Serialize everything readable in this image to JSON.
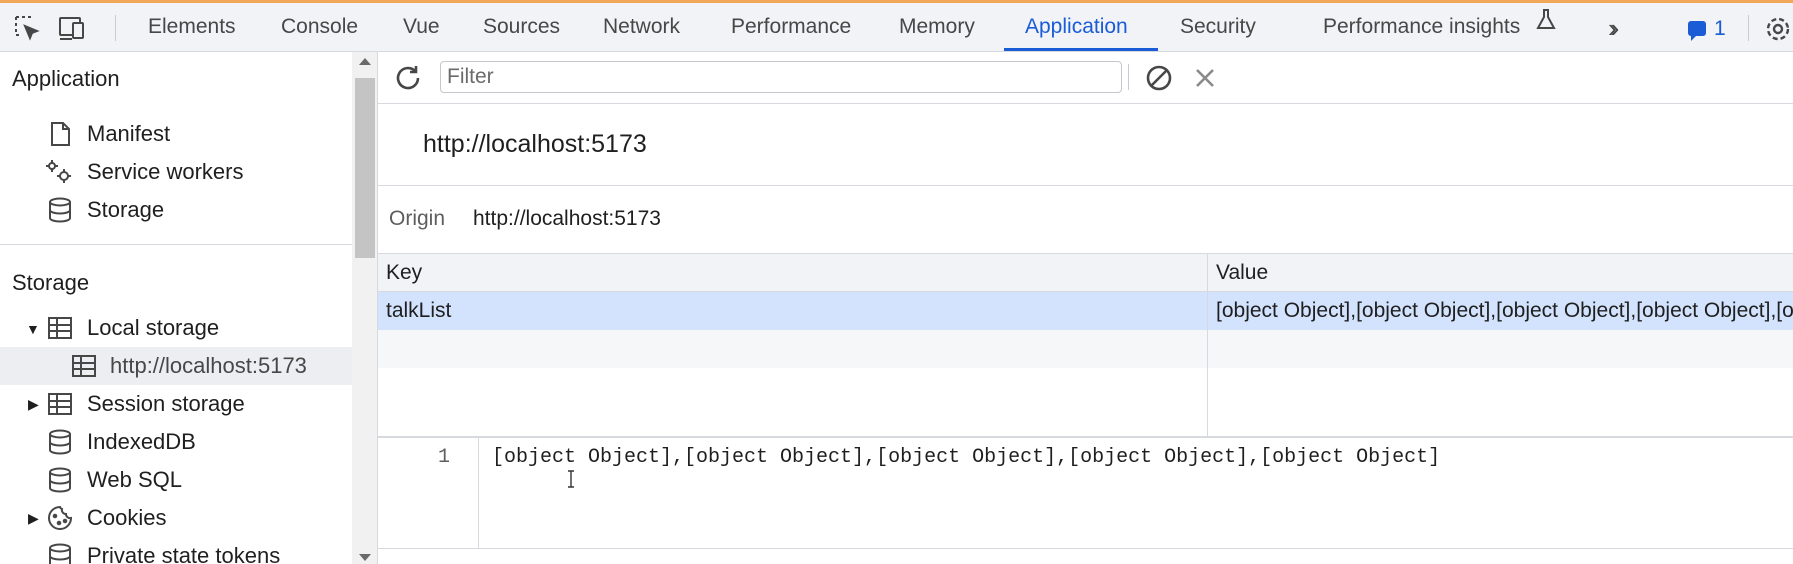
{
  "tabs": [
    {
      "label": "Elements"
    },
    {
      "label": "Console"
    },
    {
      "label": "Vue"
    },
    {
      "label": "Sources"
    },
    {
      "label": "Network"
    },
    {
      "label": "Performance"
    },
    {
      "label": "Memory"
    },
    {
      "label": "Application",
      "active": true
    },
    {
      "label": "Security"
    },
    {
      "label": "Performance insights"
    }
  ],
  "issues_count": "1",
  "sidebar": {
    "application_title": "Application",
    "application_items": [
      {
        "label": "Manifest",
        "icon": "document-icon"
      },
      {
        "label": "Service workers",
        "icon": "gears-icon"
      },
      {
        "label": "Storage",
        "icon": "database-icon"
      }
    ],
    "storage_title": "Storage",
    "storage_items": [
      {
        "label": "Local storage",
        "icon": "table-icon",
        "expanded": true
      },
      {
        "label": "http://localhost:5173",
        "icon": "table-icon",
        "selected": true
      },
      {
        "label": "Session storage",
        "icon": "table-icon",
        "expanded": false
      },
      {
        "label": "IndexedDB",
        "icon": "database-icon"
      },
      {
        "label": "Web SQL",
        "icon": "database-icon"
      },
      {
        "label": "Cookies",
        "icon": "cookie-icon",
        "expanded": false
      },
      {
        "label": "Private state tokens",
        "icon": "database-icon"
      }
    ]
  },
  "toolbar": {
    "filter_placeholder": "Filter"
  },
  "origin": {
    "title": "http://localhost:5173",
    "label": "Origin",
    "value": "http://localhost:5173"
  },
  "table": {
    "columns": [
      "Key",
      "Value"
    ],
    "rows": [
      {
        "key": "talkList",
        "value": "[object Object],[object Object],[object Object],[object Object],[object Object]"
      }
    ]
  },
  "preview": {
    "line_number": "1",
    "text": "[object Object],[object Object],[object Object],[object Object],[object Object]"
  },
  "colors": {
    "accent": "#1a5bd6",
    "selected_row": "#d3e3fd",
    "top_border": "#f0a858"
  }
}
